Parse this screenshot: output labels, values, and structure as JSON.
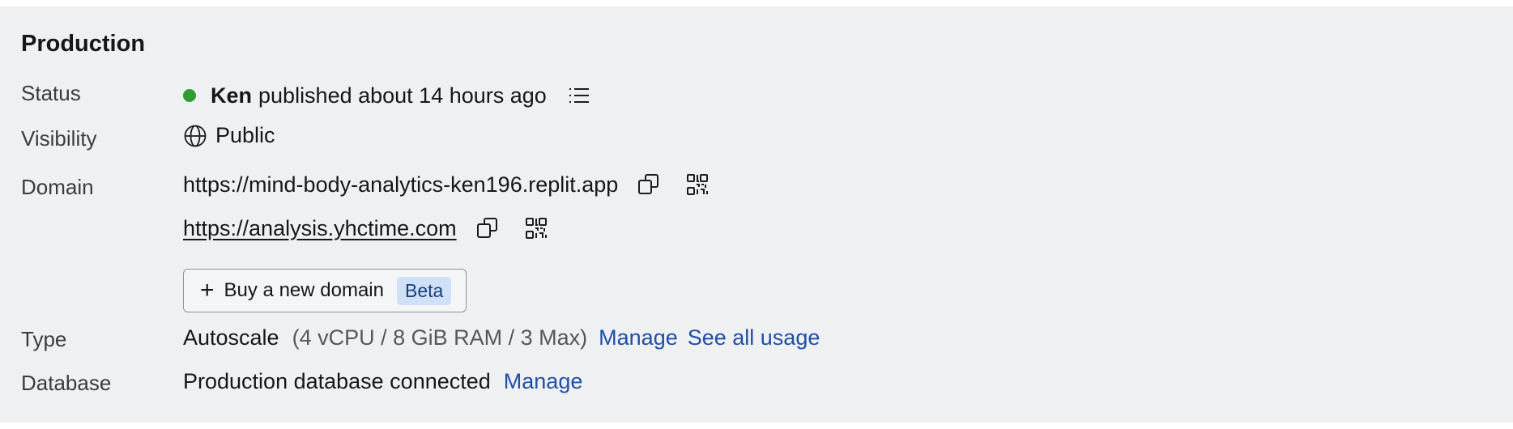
{
  "section": {
    "title": "Production"
  },
  "labels": {
    "status": "Status",
    "visibility": "Visibility",
    "domain": "Domain",
    "type": "Type",
    "database": "Database"
  },
  "status": {
    "user": "Ken",
    "text": "published about 14 hours ago",
    "dot_color": "#2e9e33",
    "history_icon": "list-icon"
  },
  "visibility": {
    "value": "Public",
    "icon": "globe-icon"
  },
  "domains": [
    {
      "url": "https://mind-body-analytics-ken196.replit.app"
    },
    {
      "url": "https://analysis.yhctime.com"
    }
  ],
  "buy_domain": {
    "label": "Buy a new domain",
    "badge": "Beta"
  },
  "type": {
    "value": "Autoscale",
    "spec": "(4 vCPU / 8 GiB RAM / 3 Max)",
    "manage_label": "Manage",
    "usage_label": "See all usage"
  },
  "database": {
    "value": "Production database connected",
    "manage_label": "Manage"
  },
  "colors": {
    "link": "#1f4fa8",
    "badge_bg": "#cfe0f7",
    "panel_bg": "#eff0f2"
  }
}
